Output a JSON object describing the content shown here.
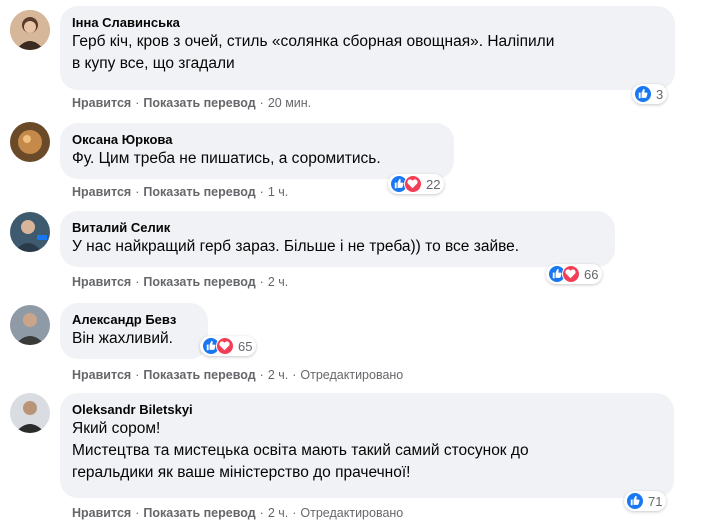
{
  "comments": [
    {
      "author": "Інна Славинська",
      "lines": [
        "Герб кіч, кров з очей, стиль «солянка сборная овощная». Наліпили",
        "в купу все, що згадали"
      ],
      "like": "Нравится",
      "translate": "Показать перевод",
      "time": "20 мин.",
      "reactions": [
        "like"
      ],
      "count": "3",
      "edited": ""
    },
    {
      "author": "Оксана Юркова",
      "lines": [
        "Фу. Цим треба не пишатись, а соромитись."
      ],
      "like": "Нравится",
      "translate": "Показать перевод",
      "time": "1 ч.",
      "reactions": [
        "like",
        "love"
      ],
      "count": "22",
      "edited": ""
    },
    {
      "author": "Виталий Селик",
      "lines": [
        "У нас найкращий герб зараз. Більше і не треба)) то все зайве."
      ],
      "like": "Нравится",
      "translate": "Показать перевод",
      "time": "2 ч.",
      "reactions": [
        "like",
        "love"
      ],
      "count": "66",
      "edited": ""
    },
    {
      "author": "Александр Бевз",
      "lines": [
        "Він жахливий."
      ],
      "like": "Нравится",
      "translate": "Показать перевод",
      "time": "2 ч.",
      "reactions": [
        "like",
        "love"
      ],
      "count": "65",
      "edited": "Отредактировано"
    },
    {
      "author": "Oleksandr Biletskyi",
      "lines": [
        "Який сором!",
        "Мистецтва та мистецька освіта мають такий самий стосунок до",
        "геральдики як ваше міністерство до прачечної!"
      ],
      "like": "Нравится",
      "translate": "Показать перевод",
      "time": "2 ч.",
      "reactions": [
        "like"
      ],
      "count": "71",
      "edited": "Отредактировано"
    }
  ],
  "colors": {
    "like_blue": "#1877f2",
    "love_red": "#f33e58",
    "bubble": "#f0f2f5",
    "meta": "#65676b"
  }
}
